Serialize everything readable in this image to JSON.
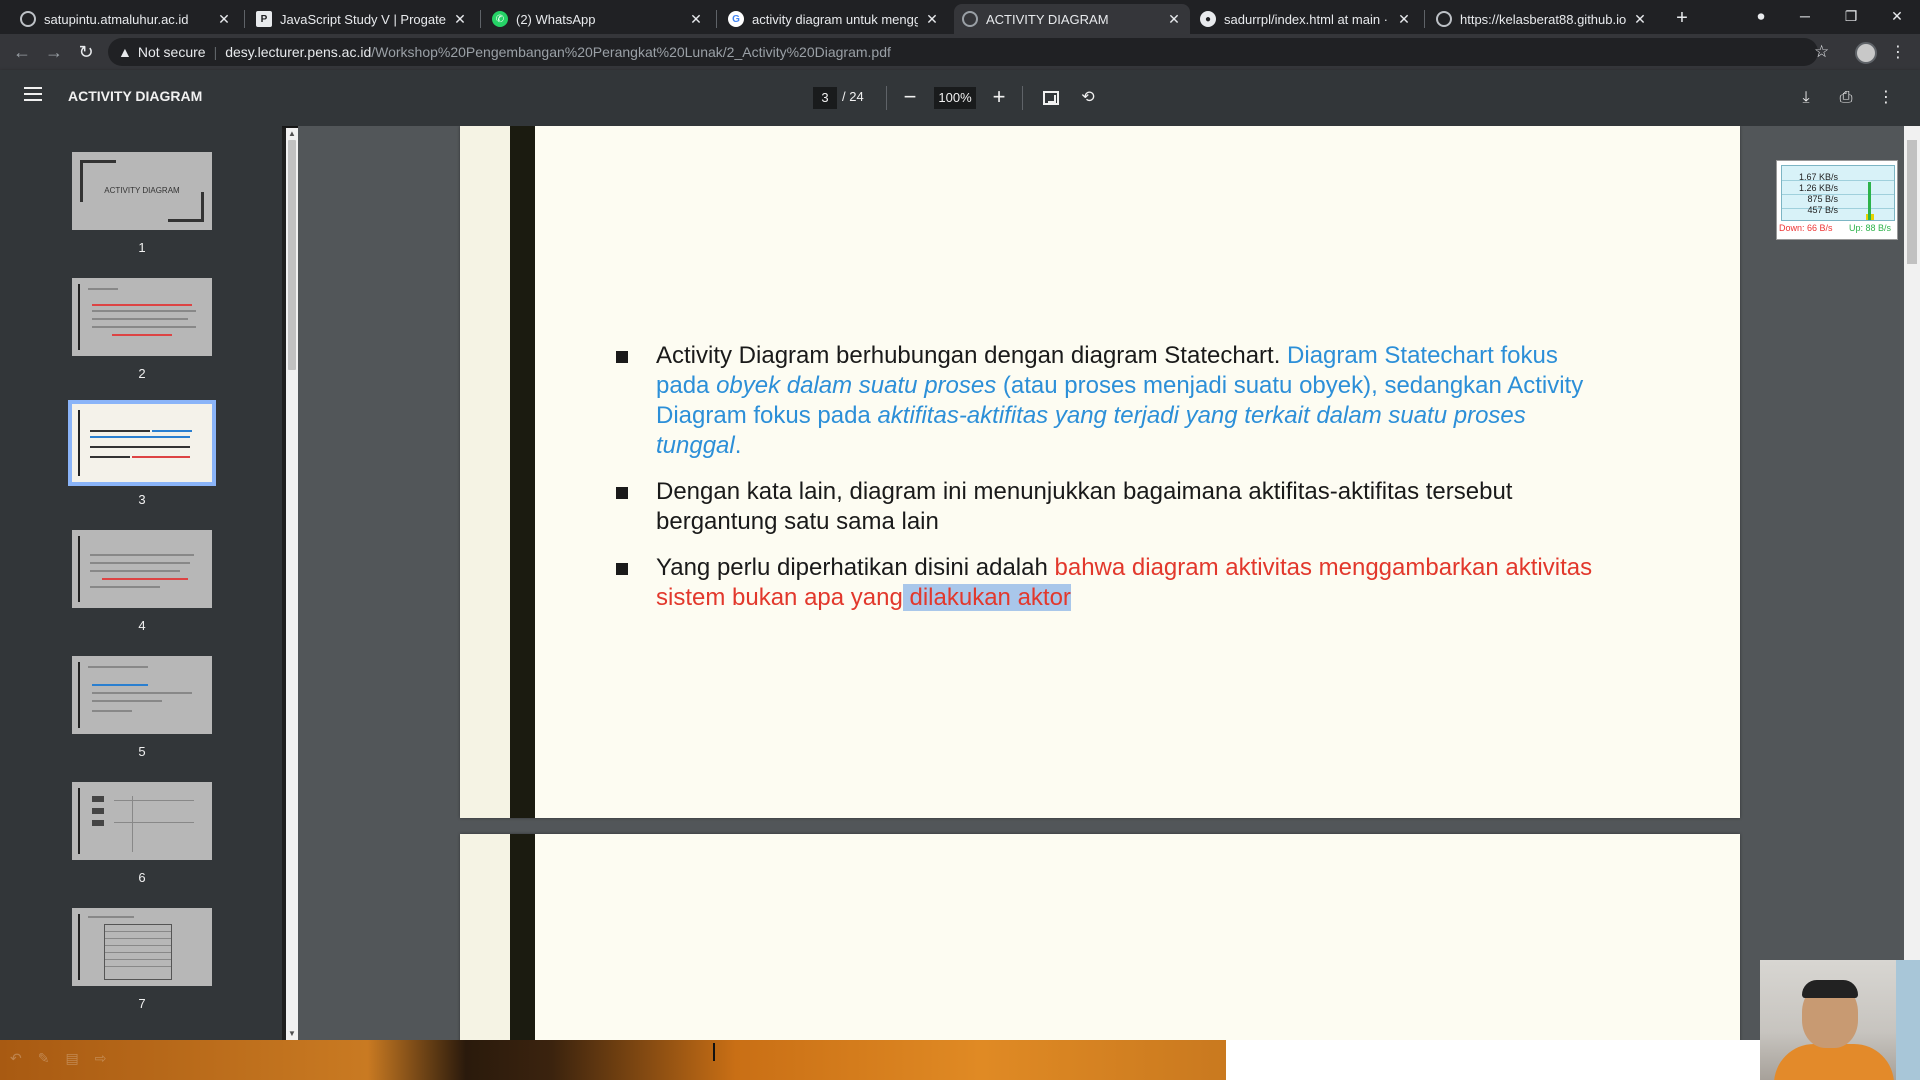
{
  "browser": {
    "tabs": [
      {
        "title": "satupintu.atmaluhur.ac.id",
        "icon": "globe-icon"
      },
      {
        "title": "JavaScript Study V | Progate - Be",
        "icon": "progate-icon"
      },
      {
        "title": "(2) WhatsApp",
        "icon": "whatsapp-icon"
      },
      {
        "title": "activity diagram untuk menggam",
        "icon": "google-icon"
      },
      {
        "title": "ACTIVITY DIAGRAM",
        "icon": "globe-icon",
        "active": true
      },
      {
        "title": "sadurrpl/index.html at main · kel",
        "icon": "github-icon"
      },
      {
        "title": "https://kelasberat88.github.io/s",
        "icon": "globe-icon"
      }
    ],
    "address": {
      "security_label": "Not secure",
      "host": "desy.lecturer.pens.ac.id",
      "path": "/Workshop%20Pengembangan%20Perangkat%20Lunak/2_Activity%20Diagram.pdf"
    }
  },
  "pdf": {
    "title": "ACTIVITY DIAGRAM",
    "current_page": "3",
    "total_pages": "/ 24",
    "zoom": "100%"
  },
  "thumbnails": {
    "labels": [
      "1",
      "2",
      "3",
      "4",
      "5",
      "6",
      "7"
    ],
    "cover_text": "ACTIVITY DIAGRAM",
    "selected_page": 3
  },
  "slide": {
    "bullet1": {
      "black": "Activity Diagram berhubungan dengan diagram Statechart. ",
      "blue1": "Diagram Statechart fokus pada ",
      "blue_italic1": "obyek dalam suatu proses",
      "blue2": " (atau proses menjadi suatu obyek), sedangkan Activity Diagram fokus pada ",
      "blue_italic2": "aktifitas-aktifitas yang terjadi yang terkait dalam suatu proses tunggal",
      "blue3": "."
    },
    "bullet2": "Dengan kata lain, diagram ini menunjukkan bagaimana aktifitas-aktifitas tersebut bergantung satu sama lain",
    "bullet3": {
      "black": "Yang perlu diperhatikan disini adalah ",
      "red": "bahwa diagram aktivitas menggambarkan aktivitas sistem bukan apa yang",
      "red_highlight": " dilakukan aktor"
    }
  },
  "netmeter": {
    "values": [
      "1.67 KB/s",
      "1.26 KB/s",
      "875 B/s",
      "457 B/s"
    ],
    "down": "Down: 66 B/s",
    "up": "Up: 88 B/s"
  },
  "colors": {
    "accent_blue": "#2c8fd8",
    "accent_red": "#e2382c",
    "selection_outline": "#8ab4f8"
  }
}
